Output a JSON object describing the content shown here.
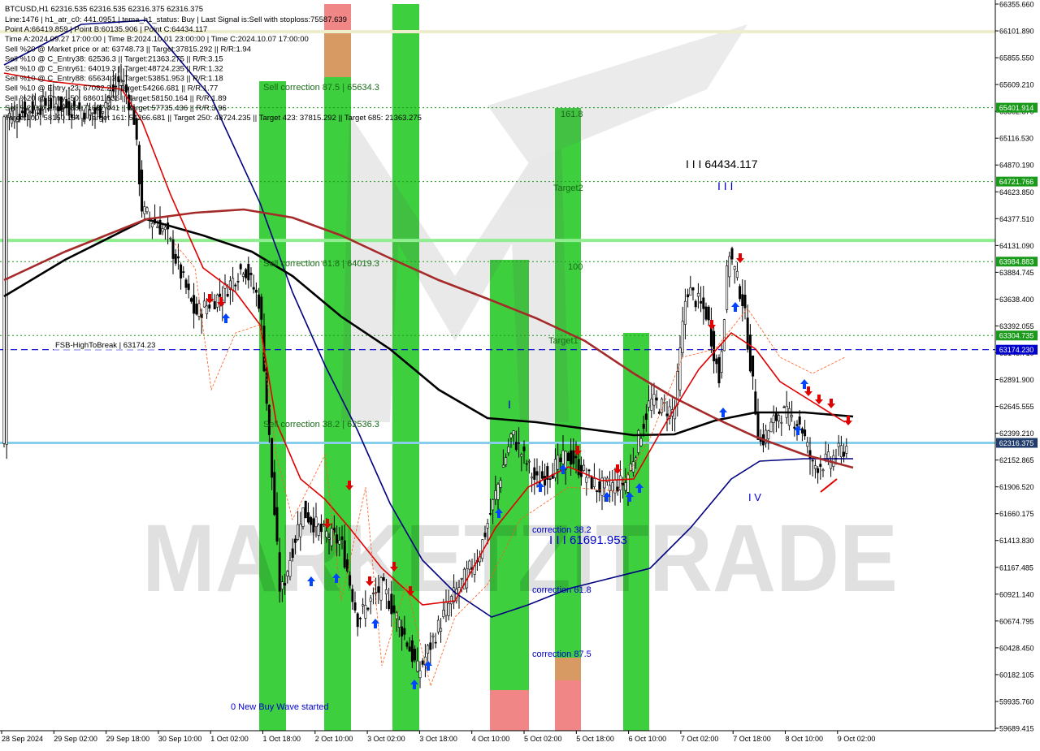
{
  "chart_data": {
    "type": "candlestick",
    "symbol_header": "BTCUSD,H1  62316.535 62316.535 62316.375 62316.375",
    "info_lines": [
      "Line:1476 | h1_atr_c0: 441.0951 | tema_h1_status: Buy | Last Signal is:Sell with stoploss:75587.639",
      "Point A:66419.859 | Point B:60135.906 | Point C:64434.117",
      "Time A:2024.09.27 17:00:00 | Time B:2024.10.01 23:00:00 | Time C:2024.10.07 17:00:00",
      "Sell %20 @ Market price or at: 63748.73 || Target:37815.292 || R/R:1.94",
      "Sell %10 @ C_Entry38: 62536.3 || Target:21363.275 || R/R:3.15",
      "Sell %10 @ C_Entry61: 64019.3 || Target:48724.235 || R/R:1.32",
      "Sell %10 @ C_Entry88: 65634.3 || Target:53851.953 || R/R:1.18",
      "Sell %10 @ Entry -23: 67082.2 || Target:54266.681 || R/R:1.77",
      "Sell %20 @ Entry -50: 68601.836 || Target:58150.164 || R/R:1.89",
      "Sell %20 @ Entry -88: 71667.441 || Target:57735.436 || R/R:3.96",
      "Target100: 58150.164 || Target 161: 54266.681 || Target 250: 48724.235 || Target 423: 37815.292 || Target 685: 21363.275"
    ],
    "y_axis": {
      "ylim": [
        59689.415,
        66355.66
      ],
      "tick_labels": [
        "66355.660",
        "66101.890",
        "65855.550",
        "65609.210",
        "65362.870",
        "65116.530",
        "64870.190",
        "64623.850",
        "64377.510",
        "64131.090",
        "63884.745",
        "63638.400",
        "63392.055",
        "63145.710",
        "62891.900",
        "62645.555",
        "62399.210",
        "62152.865",
        "61906.520",
        "61660.175",
        "61413.830",
        "61167.485",
        "60921.140",
        "60674.795",
        "60428.450",
        "60182.105",
        "59935.760",
        "59689.415"
      ]
    },
    "x_axis": {
      "tick_labels": [
        "28 Sep 2024",
        "29 Sep 02:00",
        "29 Sep 18:00",
        "30 Sep 10:00",
        "1 Oct 02:00",
        "1 Oct 18:00",
        "2 Oct 10:00",
        "3 Oct 02:00",
        "3 Oct 18:00",
        "4 Oct 10:00",
        "5 Oct 02:00",
        "5 Oct 18:00",
        "6 Oct 10:00",
        "7 Oct 02:00",
        "7 Oct 18:00",
        "8 Oct 10:00",
        "9 Oct 02:00"
      ]
    },
    "price_levels": [
      {
        "value": 66101.89,
        "label": "",
        "color": "#eeeecc",
        "style": "solid"
      },
      {
        "value": 65401.914,
        "label": "65401.914",
        "color": "#1a9a1a",
        "style": "dotted"
      },
      {
        "value": 64721.766,
        "label": "64721.766",
        "color": "#1a9a1a",
        "style": "dotted"
      },
      {
        "value": 64180.0,
        "label": "",
        "color": "#90ee90",
        "style": "solid"
      },
      {
        "value": 63984.883,
        "label": "63984.883",
        "color": "#1a9a1a",
        "style": "dotted"
      },
      {
        "value": 63304.735,
        "label": "63304.735",
        "color": "#1a9a1a",
        "style": "dotted"
      },
      {
        "value": 63174.23,
        "label": "63174.230",
        "color": "#0000cc",
        "style": "dashed"
      },
      {
        "value": 62316.375,
        "label": "62316.375",
        "color": "#87ceeb",
        "style": "solid"
      }
    ],
    "text_annotations": [
      {
        "text": "Sell correction 87.5 | 65634.3",
        "color": "#1a6a1a"
      },
      {
        "text": "Sell correction 61.8 | 64019.3",
        "color": "#1a6a1a"
      },
      {
        "text": "Sell correction 38.2 | 62536.3",
        "color": "#1a6a1a"
      },
      {
        "text": "FSB-HighToBreak | 63174.23",
        "color": "#000000"
      },
      {
        "text": "161.8",
        "color": "#1a6a1a"
      },
      {
        "text": "Target2",
        "color": "#1a6a1a"
      },
      {
        "text": "100",
        "color": "#1a6a1a"
      },
      {
        "text": "Target1",
        "color": "#1a6a1a"
      },
      {
        "text": "I I I 64434.117",
        "color": "#000000"
      },
      {
        "text": "I I I",
        "color": "#0000cc"
      },
      {
        "text": "I",
        "color": "#0000cc"
      },
      {
        "text": "I V",
        "color": "#0000cc"
      },
      {
        "text": "correction 38.2",
        "color": "#0000cc"
      },
      {
        "text": "I I I 61691.953",
        "color": "#0000cc"
      },
      {
        "text": "correction 61.8",
        "color": "#0000cc"
      },
      {
        "text": "correction 87.5",
        "color": "#0000cc"
      },
      {
        "text": "0 New Buy Wave started",
        "color": "#0000cc"
      }
    ],
    "watermark": "MARKETZITRADE",
    "series": [
      {
        "style": "ma-black"
      },
      {
        "style": "ma-darkred"
      },
      {
        "style": "ma-navy"
      },
      {
        "style": "ma-red"
      }
    ],
    "colors": {
      "candle": "#000000",
      "bull_band": "#33cc33",
      "bear_band": "#f08080",
      "orange_band": "#d4955a",
      "buy_arrow": "#0044ff",
      "sell_arrow": "#e00000"
    }
  }
}
